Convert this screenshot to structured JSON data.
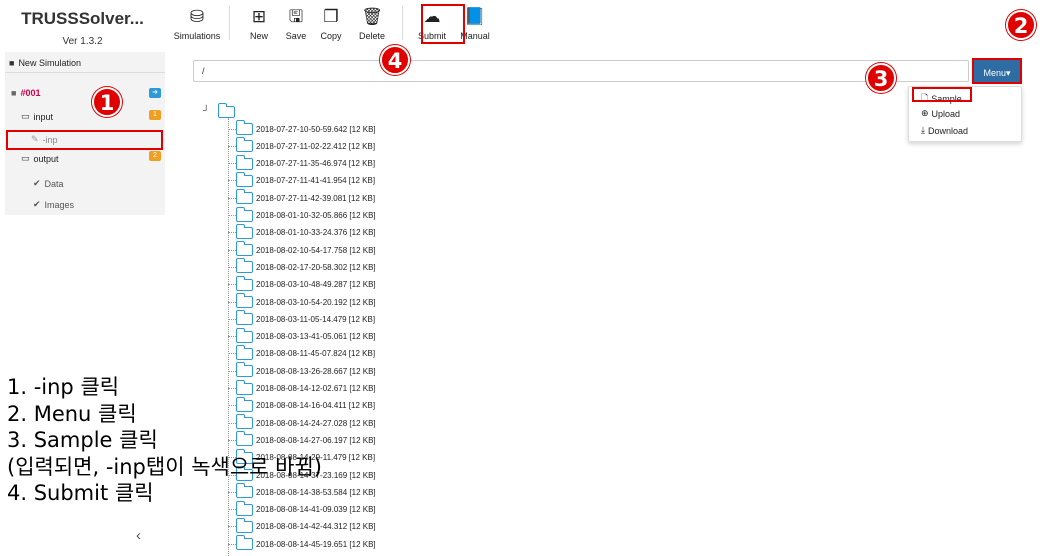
{
  "brand": {
    "title": "TRUSSSolver...",
    "version": "Ver 1.3.2"
  },
  "toolbar": [
    {
      "id": "simulations",
      "label": "Simulations",
      "icon": "cubes-icon",
      "glyph": "⛁"
    },
    {
      "id": "new",
      "label": "New",
      "icon": "plus-square-icon",
      "glyph": "⊞"
    },
    {
      "id": "save",
      "label": "Save",
      "icon": "floppy-icon",
      "glyph": "🖫"
    },
    {
      "id": "copy",
      "label": "Copy",
      "icon": "copy-icon",
      "glyph": "❐"
    },
    {
      "id": "delete",
      "label": "Delete",
      "icon": "trash-icon",
      "glyph": "🗑"
    },
    {
      "id": "submit",
      "label": "Submit",
      "icon": "cloud-upload-icon",
      "glyph": "☁"
    },
    {
      "id": "manual",
      "label": "Manual",
      "icon": "book-icon",
      "glyph": "📘"
    }
  ],
  "sidebar": {
    "new_simulation": "New Simulation",
    "sim_name": "#001",
    "input_label": "input",
    "input_count": "1",
    "inp_item": "-inp",
    "output_label": "output",
    "output_count": "2",
    "data_item": "Data",
    "images_item": "Images"
  },
  "path": "/",
  "menu": {
    "button_label": "Menu▾",
    "items": [
      "Sample",
      "Upload",
      "Download"
    ]
  },
  "files": [
    "2018-07-27-10-50-59.642 [12 KB]",
    "2018-07-27-11-02-22.412 [12 KB]",
    "2018-07-27-11-35-46.974 [12 KB]",
    "2018-07-27-11-41-41.954 [12 KB]",
    "2018-07-27-11-42-39.081 [12 KB]",
    "2018-08-01-10-32-05.866 [12 KB]",
    "2018-08-01-10-33-24.376 [12 KB]",
    "2018-08-02-10-54-17.758 [12 KB]",
    "2018-08-02-17-20-58.302 [12 KB]",
    "2018-08-03-10-48-49.287 [12 KB]",
    "2018-08-03-10-54-20.192 [12 KB]",
    "2018-08-03-11-05-14.479 [12 KB]",
    "2018-08-03-13-41-05.061 [12 KB]",
    "2018-08-08-11-45-07.824 [12 KB]",
    "2018-08-08-13-26-28.667 [12 KB]",
    "2018-08-08-14-12-02.671 [12 KB]",
    "2018-08-08-14-16-04.411 [12 KB]",
    "2018-08-08-14-24-27.028 [12 KB]",
    "2018-08-08-14-27-06.197 [12 KB]",
    "2018-08-08-14-29-11.479 [12 KB]",
    "2018-08-08-14-37-23.169 [12 KB]",
    "2018-08-08-14-38-53.584 [12 KB]",
    "2018-08-08-14-41-09.039 [12 KB]",
    "2018-08-08-14-42-44.312 [12 KB]",
    "2018-08-08-14-45-19.651 [12 KB]"
  ],
  "annotations": {
    "c1": "1",
    "c2": "2",
    "c3": "3",
    "c4": "4"
  },
  "instructions": [
    "1. -inp 클릭",
    "2. Menu 클릭",
    "3. Sample 클릭",
    "(입력되면, -inp탭이 녹색으로 바뀜)",
    "4. Submit 클릭"
  ],
  "colors": {
    "accent": "#2e6da4",
    "annotation": "#e00000",
    "folder": "#2d9ad6",
    "badge_blue": "#2d9ad6",
    "badge_orange": "#f0a020"
  }
}
